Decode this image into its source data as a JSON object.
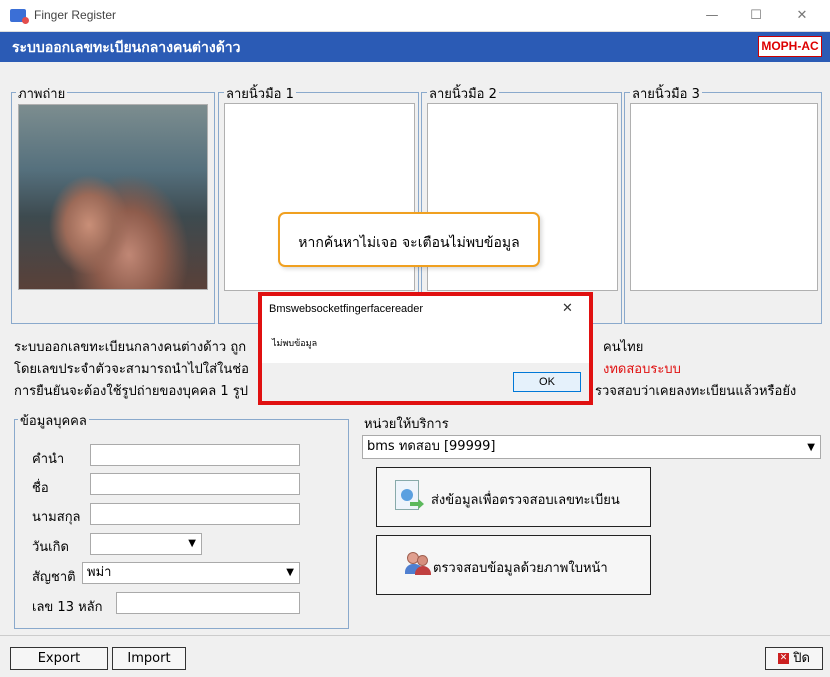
{
  "window": {
    "title": "Finger Register",
    "minimize_icon": "minimize-icon",
    "maximize_icon": "maximize-icon",
    "close_icon": "close-icon"
  },
  "header": {
    "title": "ระบบออกเลขทะเบียนกลางคนต่างด้าว",
    "badge": "MOPH-AC"
  },
  "panels": {
    "photo": "ภาพถ่าย",
    "finger1": "ลายนิ้วมือ 1",
    "finger2": "ลายนิ้วมือ 2",
    "finger3": "ลายนิ้วมือ 3"
  },
  "info": {
    "line1a": "ระบบออกเลขทะเบียนกลางคนต่างด้าว ถูก",
    "line1b": "คนไทย",
    "line2a": "โดยเลขประจำตัวจะสามารถนำไปใส่ในช่อ",
    "line2b": "งทดสอบระบบ",
    "line3a": "การยืนยันจะต้องใช้รูปถ่ายของบุคคล 1 รูป",
    "line3b": "รวจสอบว่าเคยลงทะเบียนแล้วหรือยัง"
  },
  "person": {
    "group_label": "ข้อมูลบุคคล",
    "prefix_label": "คำนำ",
    "name_label": "ชื่อ",
    "surname_label": "นามสกุล",
    "birthdate_label": "วันเกิด",
    "nationality_label": "สัญชาติ",
    "nationality_value": "พม่า",
    "id_label": "เลข 13 หลัก"
  },
  "service": {
    "label": "หน่วยให้บริการ",
    "selected": "bms ทดสอบ [99999]",
    "send_button": "ส่งข้อมูลเพื่อตรวจสอบเลขทะเบียน",
    "face_button": "ตรวจสอบข้อมูลด้วยภาพใบหน้า"
  },
  "footer": {
    "export": "Export",
    "import": "Import",
    "close": "ปิด"
  },
  "tooltip": {
    "text": "หากค้นหาไม่เจอ จะเตือนไม่พบข้อมูล"
  },
  "dialog": {
    "title": "Bmswebsocketfingerfacereader",
    "message": "ไม่พบข้อมูล",
    "ok": "OK"
  },
  "colors": {
    "header": "#2b5bb5",
    "highlight_red": "#e01010",
    "tooltip_border": "#f0a020",
    "badge_text": "#dd0000"
  }
}
